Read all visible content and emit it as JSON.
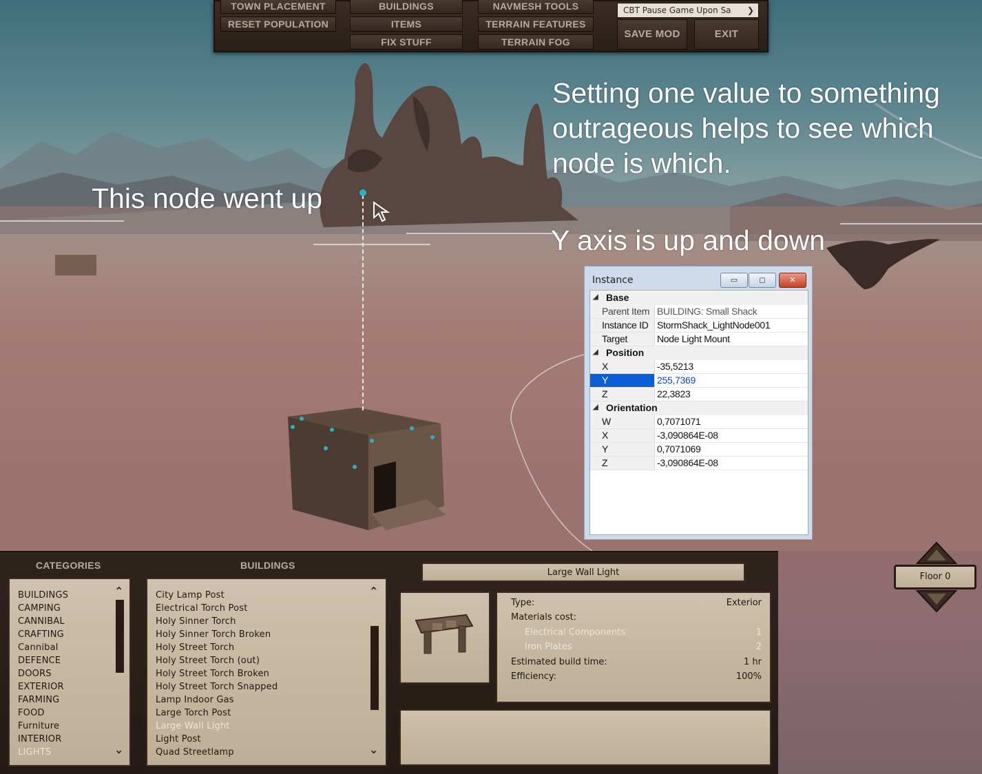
{
  "toolbar": {
    "town_placement": "TOWN PLACEMENT",
    "reset_population": "RESET POPULATION",
    "buildings": "BUILDINGS",
    "items": "ITEMS",
    "fix_stuff": "FIX STUFF",
    "navmesh_tools": "NAVMESH TOOLS",
    "terrain_features": "TERRAIN FEATURES",
    "terrain_fog": "TERRAIN FOG",
    "pause_select": "CBT Pause Game Upon Sa",
    "save_mod": "SAVE MOD",
    "exit": "EXIT"
  },
  "annotations": {
    "main": "Setting one value to something outrageous helps to see which node is which.",
    "node": "This node went up",
    "y_axis": "Y axis is up and down"
  },
  "instance_window": {
    "title": "Instance",
    "minimize": "▭",
    "maximize": "◻",
    "close": "✕",
    "base": {
      "label": "Base",
      "rows": [
        {
          "name": "Parent Item",
          "value": "BUILDING: Small Shack"
        },
        {
          "name": "Instance ID",
          "value": "StormShack_LightNode001"
        },
        {
          "name": "Target",
          "value": "Node Light Mount"
        }
      ]
    },
    "position": {
      "label": "Position",
      "rows": [
        {
          "name": "X",
          "value": "-35,5213"
        },
        {
          "name": "Y",
          "value": "255,7369"
        },
        {
          "name": "Z",
          "value": "22,3823"
        }
      ]
    },
    "orientation": {
      "label": "Orientation",
      "rows": [
        {
          "name": "W",
          "value": "0,7071071"
        },
        {
          "name": "X",
          "value": "-3,090864E-08"
        },
        {
          "name": "Y",
          "value": "0,7071069"
        },
        {
          "name": "Z",
          "value": "-3,090864E-08"
        }
      ]
    }
  },
  "bottom_panel": {
    "categories_header": "CATEGORIES",
    "buildings_header": "BUILDINGS",
    "categories": [
      "BUILDINGS",
      "CAMPING",
      "CANNIBAL",
      "CRAFTING",
      "Cannibal",
      "DEFENCE",
      "DOORS",
      "EXTERIOR",
      "FARMING",
      "FOOD",
      "Furniture",
      "INTERIOR",
      "LIGHTS"
    ],
    "selected_category": "LIGHTS",
    "buildings": [
      "City Lamp Post",
      "Electrical Torch Post",
      "Holy Sinner Torch",
      "Holy Sinner Torch Broken",
      "Holy Street Torch",
      "Holy Street Torch (out)",
      "Holy Street Torch Broken",
      "Holy Street Torch Snapped",
      "Lamp Indoor Gas",
      "Large Torch Post",
      "Large Wall Light",
      "Light Post",
      "Quad Streetlamp"
    ],
    "selected_building": "Large Wall Light",
    "detail": {
      "title": "Large Wall Light",
      "type_label": "Type:",
      "type_value": "Exterior",
      "materials_label": "Materials cost:",
      "materials": [
        {
          "name": "Electrical Components",
          "qty": "1"
        },
        {
          "name": "Iron Plates",
          "qty": "2"
        }
      ],
      "build_time_label": "Estimated build time:",
      "build_time_value": "1 hr",
      "efficiency_label": "Efficiency:",
      "efficiency_value": "100%"
    },
    "floor_label": "Floor 0"
  }
}
